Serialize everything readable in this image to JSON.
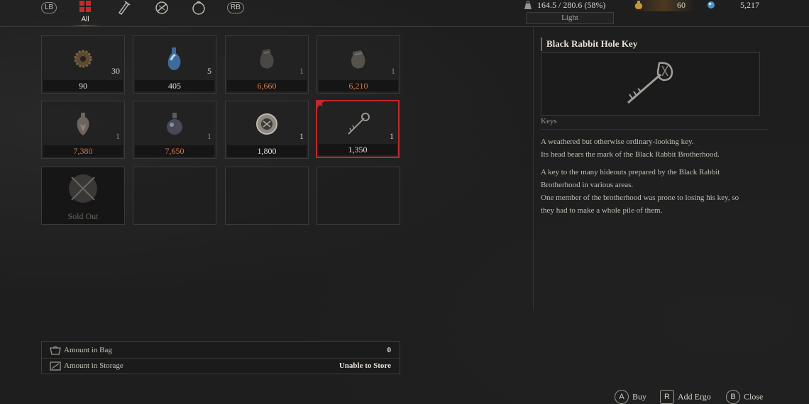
{
  "tabs": {
    "left_bumper": "LB",
    "right_bumper": "RB",
    "all_label": "All",
    "items": [
      {
        "icon": "grid-icon",
        "active": true
      },
      {
        "icon": "consumable-icon",
        "active": false
      },
      {
        "icon": "material-icon",
        "active": false
      },
      {
        "icon": "amulet-icon",
        "active": false
      }
    ]
  },
  "stats": {
    "weight": "164.5 / 280.6 (58%)",
    "weight_class": "Light",
    "ergo_item_count": "60",
    "ergo": "5,217"
  },
  "grid": [
    {
      "icon": "gear-cog-icon",
      "qty": "30",
      "price": "90",
      "price_orange": false,
      "qty_dim": false
    },
    {
      "icon": "blue-vial-icon",
      "qty": "5",
      "price": "405",
      "price_orange": false,
      "qty_dim": false
    },
    {
      "icon": "dark-pouch-icon",
      "qty": "1",
      "price": "6,660",
      "price_orange": true,
      "qty_dim": true
    },
    {
      "icon": "grey-pouch-icon",
      "qty": "1",
      "price": "6,210",
      "price_orange": true,
      "qty_dim": true
    },
    {
      "icon": "heart-flask-icon",
      "qty": "1",
      "price": "7,380",
      "price_orange": true,
      "qty_dim": true
    },
    {
      "icon": "round-flask-icon",
      "qty": "1",
      "price": "7,650",
      "price_orange": true,
      "qty_dim": true
    },
    {
      "icon": "medallion-icon",
      "qty": "1",
      "price": "1,800",
      "price_orange": false,
      "qty_dim": false
    },
    {
      "icon": "key-icon",
      "qty": "1",
      "price": "1,350",
      "price_orange": false,
      "qty_dim": false,
      "selected": true
    },
    {
      "icon": "sold-out-icon",
      "sold_label": "Sold Out"
    },
    {
      "empty": true
    },
    {
      "empty": true
    },
    {
      "empty": true
    }
  ],
  "info": {
    "bag_label": "Amount in Bag",
    "bag_value": "0",
    "storage_label": "Amount in Storage",
    "storage_value": "Unable to Store"
  },
  "detail": {
    "title": "Black Rabbit Hole Key",
    "category": "Keys",
    "desc_lines_1": [
      "A weathered but otherwise ordinary-looking key.",
      "Its head bears the mark of the Black Rabbit Brotherhood."
    ],
    "desc_lines_2": [
      "A key to the many hideouts prepared by the Black Rabbit",
      "Brotherhood in various areas.",
      "One member of the brotherhood was prone to losing his key, so",
      "they had to make a whole pile of them."
    ]
  },
  "controls": {
    "buy_button": "A",
    "buy_label": "Buy",
    "add_ergo_button": "R",
    "add_ergo_label": "Add Ergo",
    "close_button": "B",
    "close_label": "Close"
  }
}
